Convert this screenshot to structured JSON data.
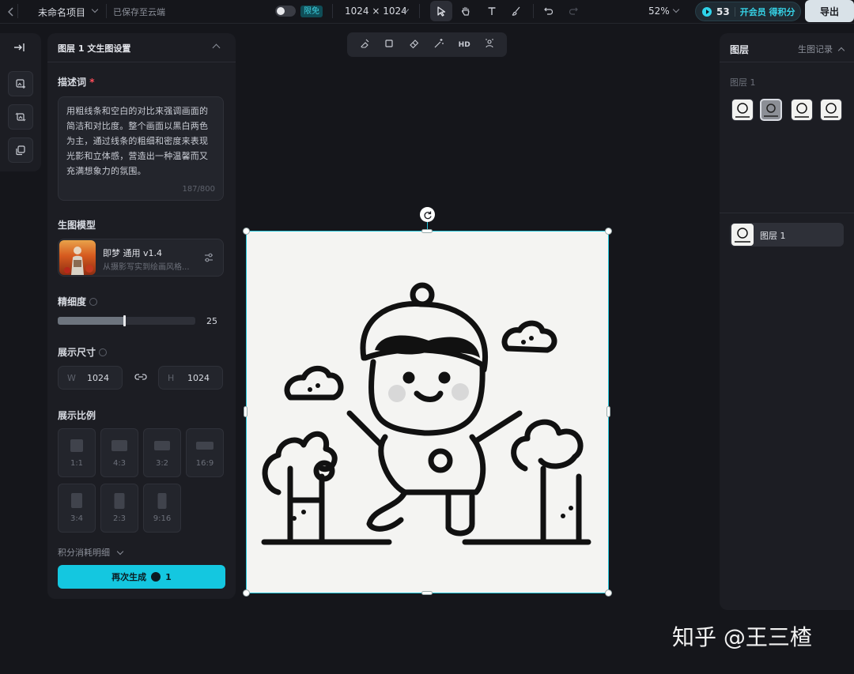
{
  "topbar": {
    "back_icon": "chevron-left-icon",
    "project_name": "未命名项目",
    "save_status": "已保存至云端",
    "free_badge": "限免",
    "canvas_size": "1024 × 1024",
    "zoom": "52%",
    "credits": "53",
    "member_label": "开会员 得积分",
    "export_label": "导出",
    "tools": [
      "select-icon",
      "hand-icon",
      "text-icon",
      "brush-icon",
      "undo-icon",
      "redo-icon"
    ]
  },
  "mini_bar": {
    "icons": [
      "expand-panel-icon",
      "image-generate-icon",
      "image-transform-icon",
      "layers-copy-icon"
    ]
  },
  "settings": {
    "title": "图层 1 文生图设置",
    "prompt_label": "描述词",
    "required_mark": "*",
    "prompt_text": "用粗线条和空白的对比来强调画面的简洁和对比度。整个画面以黑白两色为主，通过线条的粗细和密度来表现光影和立体感，营造出一种温馨而又充满想象力的氛围。",
    "prompt_count": "187/800",
    "model_label": "生图模型",
    "model_name": "即梦 通用 v1.4",
    "model_desc": "从摄影写实到绘画风格...",
    "detail_label": "精细度",
    "detail_value": "25",
    "detail_fraction": 0.48,
    "size_label": "展示尺寸",
    "width_prefix": "W",
    "width_value": "1024",
    "height_prefix": "H",
    "height_value": "1024",
    "ratio_label": "展示比例",
    "ratios": [
      "1:1",
      "4:3",
      "3:2",
      "16:9",
      "3:4",
      "2:3",
      "9:16"
    ],
    "cost_detail": "积分消耗明细",
    "regen_label": "再次生成",
    "regen_cost": "1"
  },
  "float_tools": [
    "erase-icon",
    "crop-icon",
    "eraser-icon",
    "magic-wand-icon",
    "HD",
    "cutout-icon"
  ],
  "right_panel": {
    "layers_tab": "图层",
    "history_tab": "生图记录",
    "layer_group": "图层 1",
    "layer_name": "图层 1"
  },
  "watermark": "知乎 @王三楂",
  "colors": {
    "accent": "#14c7e0",
    "background": "#15161b",
    "panel": "#1c1d23"
  }
}
